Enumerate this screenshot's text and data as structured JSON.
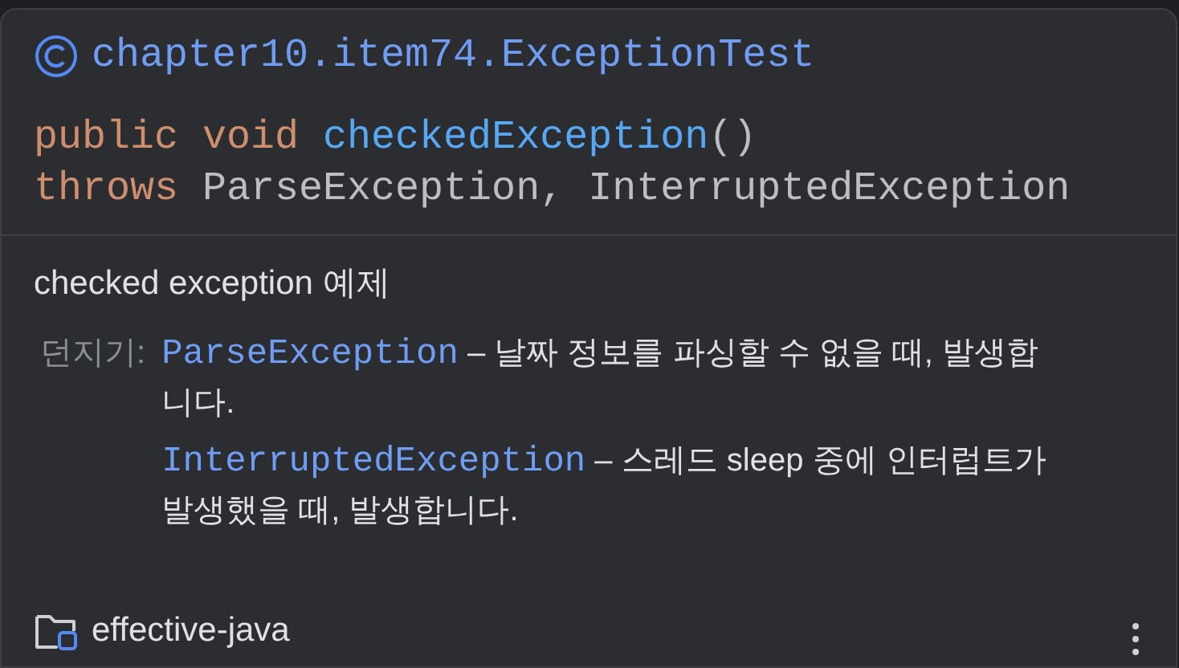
{
  "header": {
    "class_name": "chapter10.item74.ExceptionTest"
  },
  "signature": {
    "lines": [
      [
        {
          "text": "public ",
          "kind": "keyword"
        },
        {
          "text": "void ",
          "kind": "keyword"
        },
        {
          "text": "checkedException",
          "kind": "method"
        },
        {
          "text": "()",
          "kind": "plain"
        }
      ],
      [
        {
          "text": "throws ",
          "kind": "keyword"
        },
        {
          "text": "ParseException, InterruptedException",
          "kind": "plain"
        }
      ]
    ]
  },
  "description": "checked exception 예제",
  "throws": {
    "label": "던지기:",
    "items": [
      {
        "name": "ParseException",
        "description": " – 날짜 정보를 파싱할 수 없을 때, 발생합니다."
      },
      {
        "name": "InterruptedException",
        "description": " – 스레드 sleep 중에 인터럽트가 발생했을 때, 발생합니다."
      }
    ]
  },
  "footer": {
    "module": "effective-java"
  }
}
